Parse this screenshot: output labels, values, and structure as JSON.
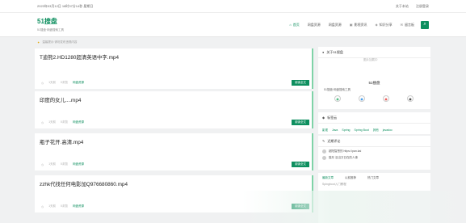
{
  "topbar": {
    "datetime": "2023年03月12日 18时37分14秒 星期日",
    "links": [
      "关于本站",
      "注册登录"
    ]
  },
  "header": {
    "site_name": "51搜盘",
    "tagline": "51搜盘·网盘搜索工具",
    "nav": [
      {
        "label": "首页",
        "icon": "home-icon",
        "active": true
      },
      {
        "label": "网盘资源",
        "icon": "",
        "active": false
      },
      {
        "label": "网盘资源",
        "icon": "",
        "active": false
      },
      {
        "label": "影视资讯",
        "icon": "film-icon",
        "active": false
      },
      {
        "label": "知识分享",
        "icon": "share-icon",
        "active": false
      },
      {
        "label": "留言板",
        "icon": "message-icon",
        "active": false
      }
    ],
    "search_icon": "search-icon"
  },
  "notice": "温馨提示:请勿发布违规内容",
  "posts": [
    {
      "title": "T迪熊2.HD1280超清英语中字.mp4",
      "meta_time": "1天前",
      "meta_views": "0浏览",
      "meta_cat": "网盘资源",
      "read": "阅读全文"
    },
    {
      "title": "印度的女儿....mp4",
      "meta_time": "1天前",
      "meta_views": "0浏览",
      "meta_cat": "网盘资源",
      "read": "阅读全文"
    },
    {
      "title": "瓶子花开.高清.mp4",
      "meta_time": "1天前",
      "meta_views": "0浏览",
      "meta_cat": "网盘资源",
      "read": "阅读全文"
    },
    {
      "title": "zzhk代找任何电影加Q976680860.mp4",
      "meta_time": "1天前",
      "meta_views": "0浏览",
      "meta_cat": "网盘资源",
      "read": "阅读全文"
    }
  ],
  "sidebar": {
    "about": {
      "title": "关于51搜盘",
      "img_alt": "图片加载中",
      "name": "51搜盘",
      "desc": "51搜盘·网盘搜索工具",
      "socials": [
        "wechat-icon",
        "qq-icon",
        "weibo-icon",
        "github-icon"
      ]
    },
    "tags": {
      "title": "标签云",
      "items": [
        "影视",
        "Java",
        "Spring",
        "Spring Boot",
        "其他",
        "javadoc"
      ]
    },
    "comments": {
      "title": "近期评论",
      "items": [
        "超阳智慧的 https://pan.kai",
        "猫东 没当万日在的人事"
      ]
    },
    "tabs": {
      "items": [
        "最新文章",
        "以前推荐",
        "热门文章"
      ],
      "first_item": "Spingboot入门教程"
    }
  },
  "colors": {
    "accent": "#0e8f5f",
    "post_border": "#7fd3a7"
  }
}
